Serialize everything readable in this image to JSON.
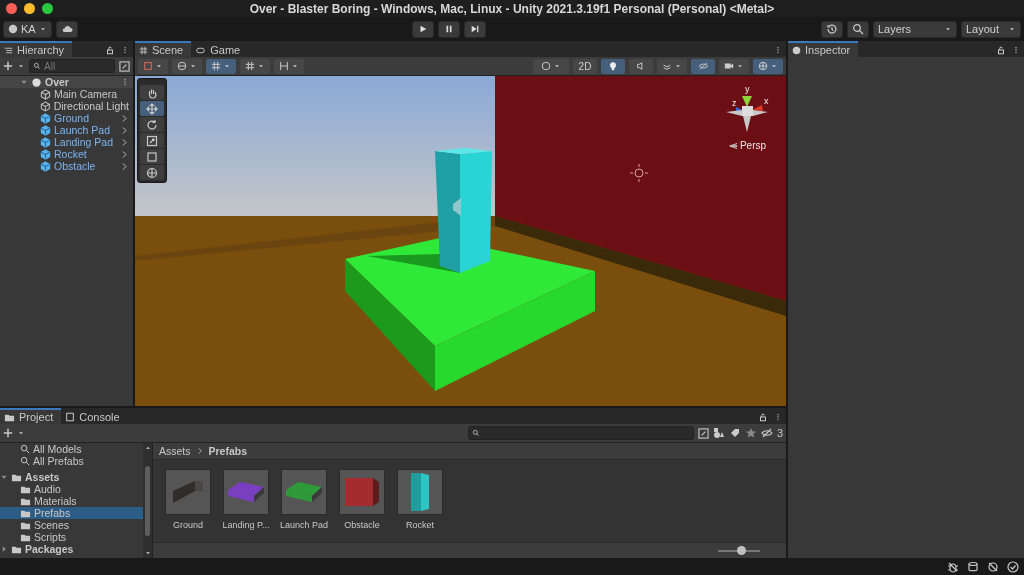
{
  "window": {
    "title": "Over - Blaster Boring - Windows, Mac, Linux - Unity 2021.3.19f1 Personal (Personal) <Metal>"
  },
  "toolbar": {
    "account": "KA",
    "layers": "Layers",
    "layout": "Layout"
  },
  "hierarchy": {
    "tab": "Hierarchy",
    "search": {
      "placeholder": "All"
    },
    "scene": {
      "name": "Over",
      "expanded": true,
      "children": [
        {
          "name": "Main Camera",
          "kind": "object"
        },
        {
          "name": "Directional Light",
          "kind": "object"
        },
        {
          "name": "Ground",
          "kind": "prefab"
        },
        {
          "name": "Launch Pad",
          "kind": "prefab"
        },
        {
          "name": "Landing Pad",
          "kind": "prefab"
        },
        {
          "name": "Rocket",
          "kind": "prefab"
        },
        {
          "name": "Obstacle",
          "kind": "prefab"
        }
      ]
    }
  },
  "scene_view": {
    "tabs": [
      {
        "label": "Scene",
        "selected": true
      },
      {
        "label": "Game",
        "selected": false
      }
    ],
    "toggle_2d": {
      "label": "2D",
      "on": false
    },
    "lighting": {
      "on": true
    },
    "hidden_objects": {
      "on": true
    },
    "tools": [
      {
        "kind": "hand",
        "selected": false
      },
      {
        "kind": "move",
        "selected": true
      },
      {
        "kind": "rotate",
        "selected": false
      },
      {
        "kind": "scale",
        "selected": false
      },
      {
        "kind": "rect",
        "selected": false
      },
      {
        "kind": "transform",
        "selected": false
      }
    ],
    "gizmo": {
      "axes": [
        "y",
        "z",
        "x"
      ],
      "projection": "Persp"
    }
  },
  "inspector": {
    "tab": "Inspector"
  },
  "project": {
    "tabs": [
      {
        "label": "Project",
        "selected": true
      },
      {
        "label": "Console",
        "selected": false
      }
    ],
    "favorites": [
      "All Models",
      "All Prefabs"
    ],
    "tree": [
      {
        "name": "Assets",
        "expanded": true,
        "children": [
          {
            "name": "Audio",
            "selected": false
          },
          {
            "name": "Materials",
            "selected": false
          },
          {
            "name": "Prefabs",
            "selected": true
          },
          {
            "name": "Scenes",
            "selected": false
          },
          {
            "name": "Scripts",
            "selected": false
          }
        ]
      },
      {
        "name": "Packages",
        "expanded": false
      }
    ],
    "breadcrumb": [
      "Assets",
      "Prefabs"
    ],
    "hidden_count": "3",
    "assets": [
      {
        "name": "Ground",
        "kind": "bar",
        "color": "#2f2c2b"
      },
      {
        "name": "Landing P...",
        "kind": "slab",
        "color": "#7a3fc0"
      },
      {
        "name": "Launch Pad",
        "kind": "slab",
        "color": "#2f9a3a"
      },
      {
        "name": "Obstacle",
        "kind": "wall",
        "color": "#a32c2e"
      },
      {
        "name": "Rocket",
        "kind": "pillar",
        "color": "#1f9c9c"
      }
    ],
    "zoom": {
      "level": 0.55
    }
  }
}
